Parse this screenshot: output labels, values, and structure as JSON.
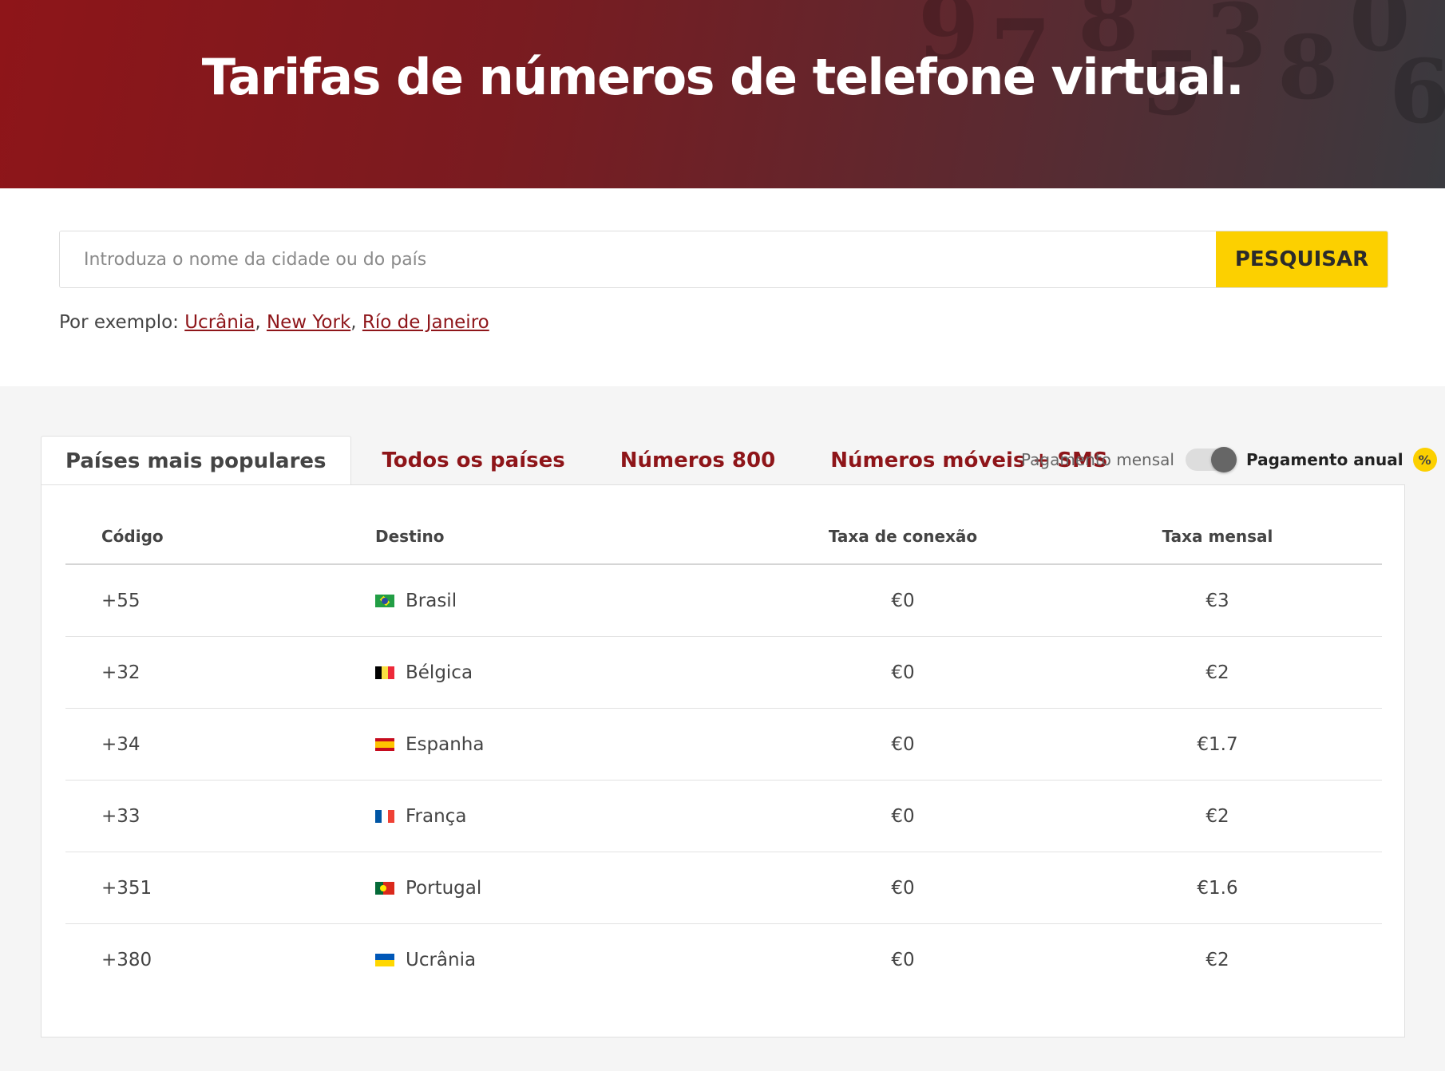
{
  "hero": {
    "title": "Tarifas de números de telefone virtual."
  },
  "search": {
    "placeholder": "Introduza o nome da cidade ou do país",
    "button_label": "PESQUISAR",
    "examples_prefix": "Por exemplo:",
    "examples": [
      "Ucrânia",
      "New York",
      "Río de Janeiro"
    ]
  },
  "tabs": [
    {
      "label": "Países mais populares",
      "active": true
    },
    {
      "label": "Todos os países",
      "active": false
    },
    {
      "label": "Números 800",
      "active": false
    },
    {
      "label": "Números móveis + SMS",
      "active": false
    }
  ],
  "billing_toggle": {
    "monthly_label": "Pagamento mensal",
    "annual_label": "Pagamento anual",
    "badge": "%",
    "annual_selected": true
  },
  "table": {
    "columns": [
      "Código",
      "Destino",
      "Taxa de conexão",
      "Taxa mensal"
    ],
    "rows": [
      {
        "code": "+55",
        "country": "Brasil",
        "flag": "brazil-flag-icon",
        "connection": "€0",
        "monthly": "€3"
      },
      {
        "code": "+32",
        "country": "Bélgica",
        "flag": "belgium-flag-icon",
        "connection": "€0",
        "monthly": "€2"
      },
      {
        "code": "+34",
        "country": "Espanha",
        "flag": "spain-flag-icon",
        "connection": "€0",
        "monthly": "€1.7"
      },
      {
        "code": "+33",
        "country": "França",
        "flag": "france-flag-icon",
        "connection": "€0",
        "monthly": "€2"
      },
      {
        "code": "+351",
        "country": "Portugal",
        "flag": "portugal-flag-icon",
        "connection": "€0",
        "monthly": "€1.6"
      },
      {
        "code": "+380",
        "country": "Ucrânia",
        "flag": "ukraine-flag-icon",
        "connection": "€0",
        "monthly": "€2"
      }
    ]
  },
  "colors": {
    "brand_red": "#8e1519",
    "accent_yellow": "#fcd000"
  }
}
